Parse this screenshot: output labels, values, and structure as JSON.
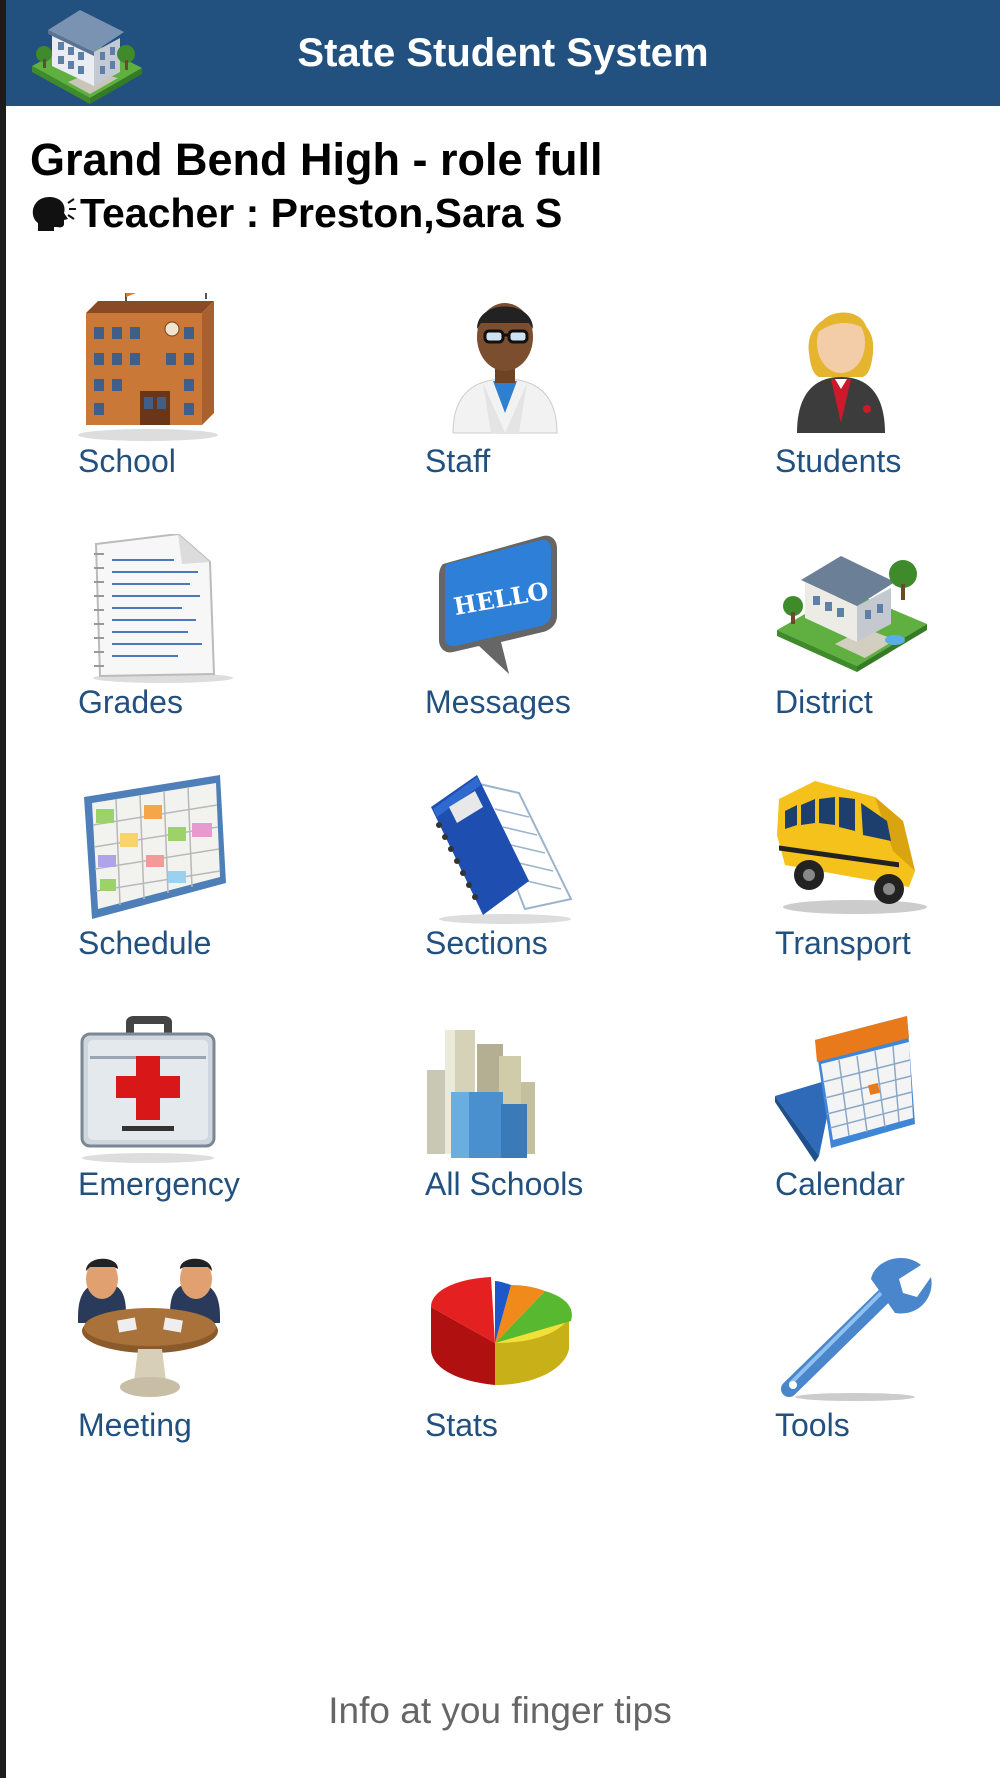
{
  "header": {
    "title": "State Student System",
    "logo_icon": "building-logo-icon",
    "background": "#22507f"
  },
  "context": {
    "school_line": "Grand Bend High - role full",
    "role_line": "Teacher : Preston,Sara S",
    "role_icon": "speaking-head-icon"
  },
  "menu": {
    "label_color": "#22507f",
    "items": [
      {
        "label": "School",
        "icon": "school-building-icon"
      },
      {
        "label": "Staff",
        "icon": "staff-person-icon"
      },
      {
        "label": "Students",
        "icon": "student-icon"
      },
      {
        "label": "Grades",
        "icon": "grades-paper-icon"
      },
      {
        "label": "Messages",
        "icon": "hello-speech-bubble-icon",
        "icon_text": "HELLO"
      },
      {
        "label": "District",
        "icon": "district-campus-icon"
      },
      {
        "label": "Schedule",
        "icon": "schedule-grid-icon"
      },
      {
        "label": "Sections",
        "icon": "notebook-icon"
      },
      {
        "label": "Transport",
        "icon": "school-bus-icon"
      },
      {
        "label": "Emergency",
        "icon": "first-aid-kit-icon"
      },
      {
        "label": "All Schools",
        "icon": "city-towers-icon"
      },
      {
        "label": "Calendar",
        "icon": "calendar-icon"
      },
      {
        "label": "Meeting",
        "icon": "meeting-table-icon"
      },
      {
        "label": "Stats",
        "icon": "pie-chart-icon"
      },
      {
        "label": "Tools",
        "icon": "wrench-icon"
      }
    ]
  },
  "footer": {
    "tagline": "Info at you finger tips"
  }
}
